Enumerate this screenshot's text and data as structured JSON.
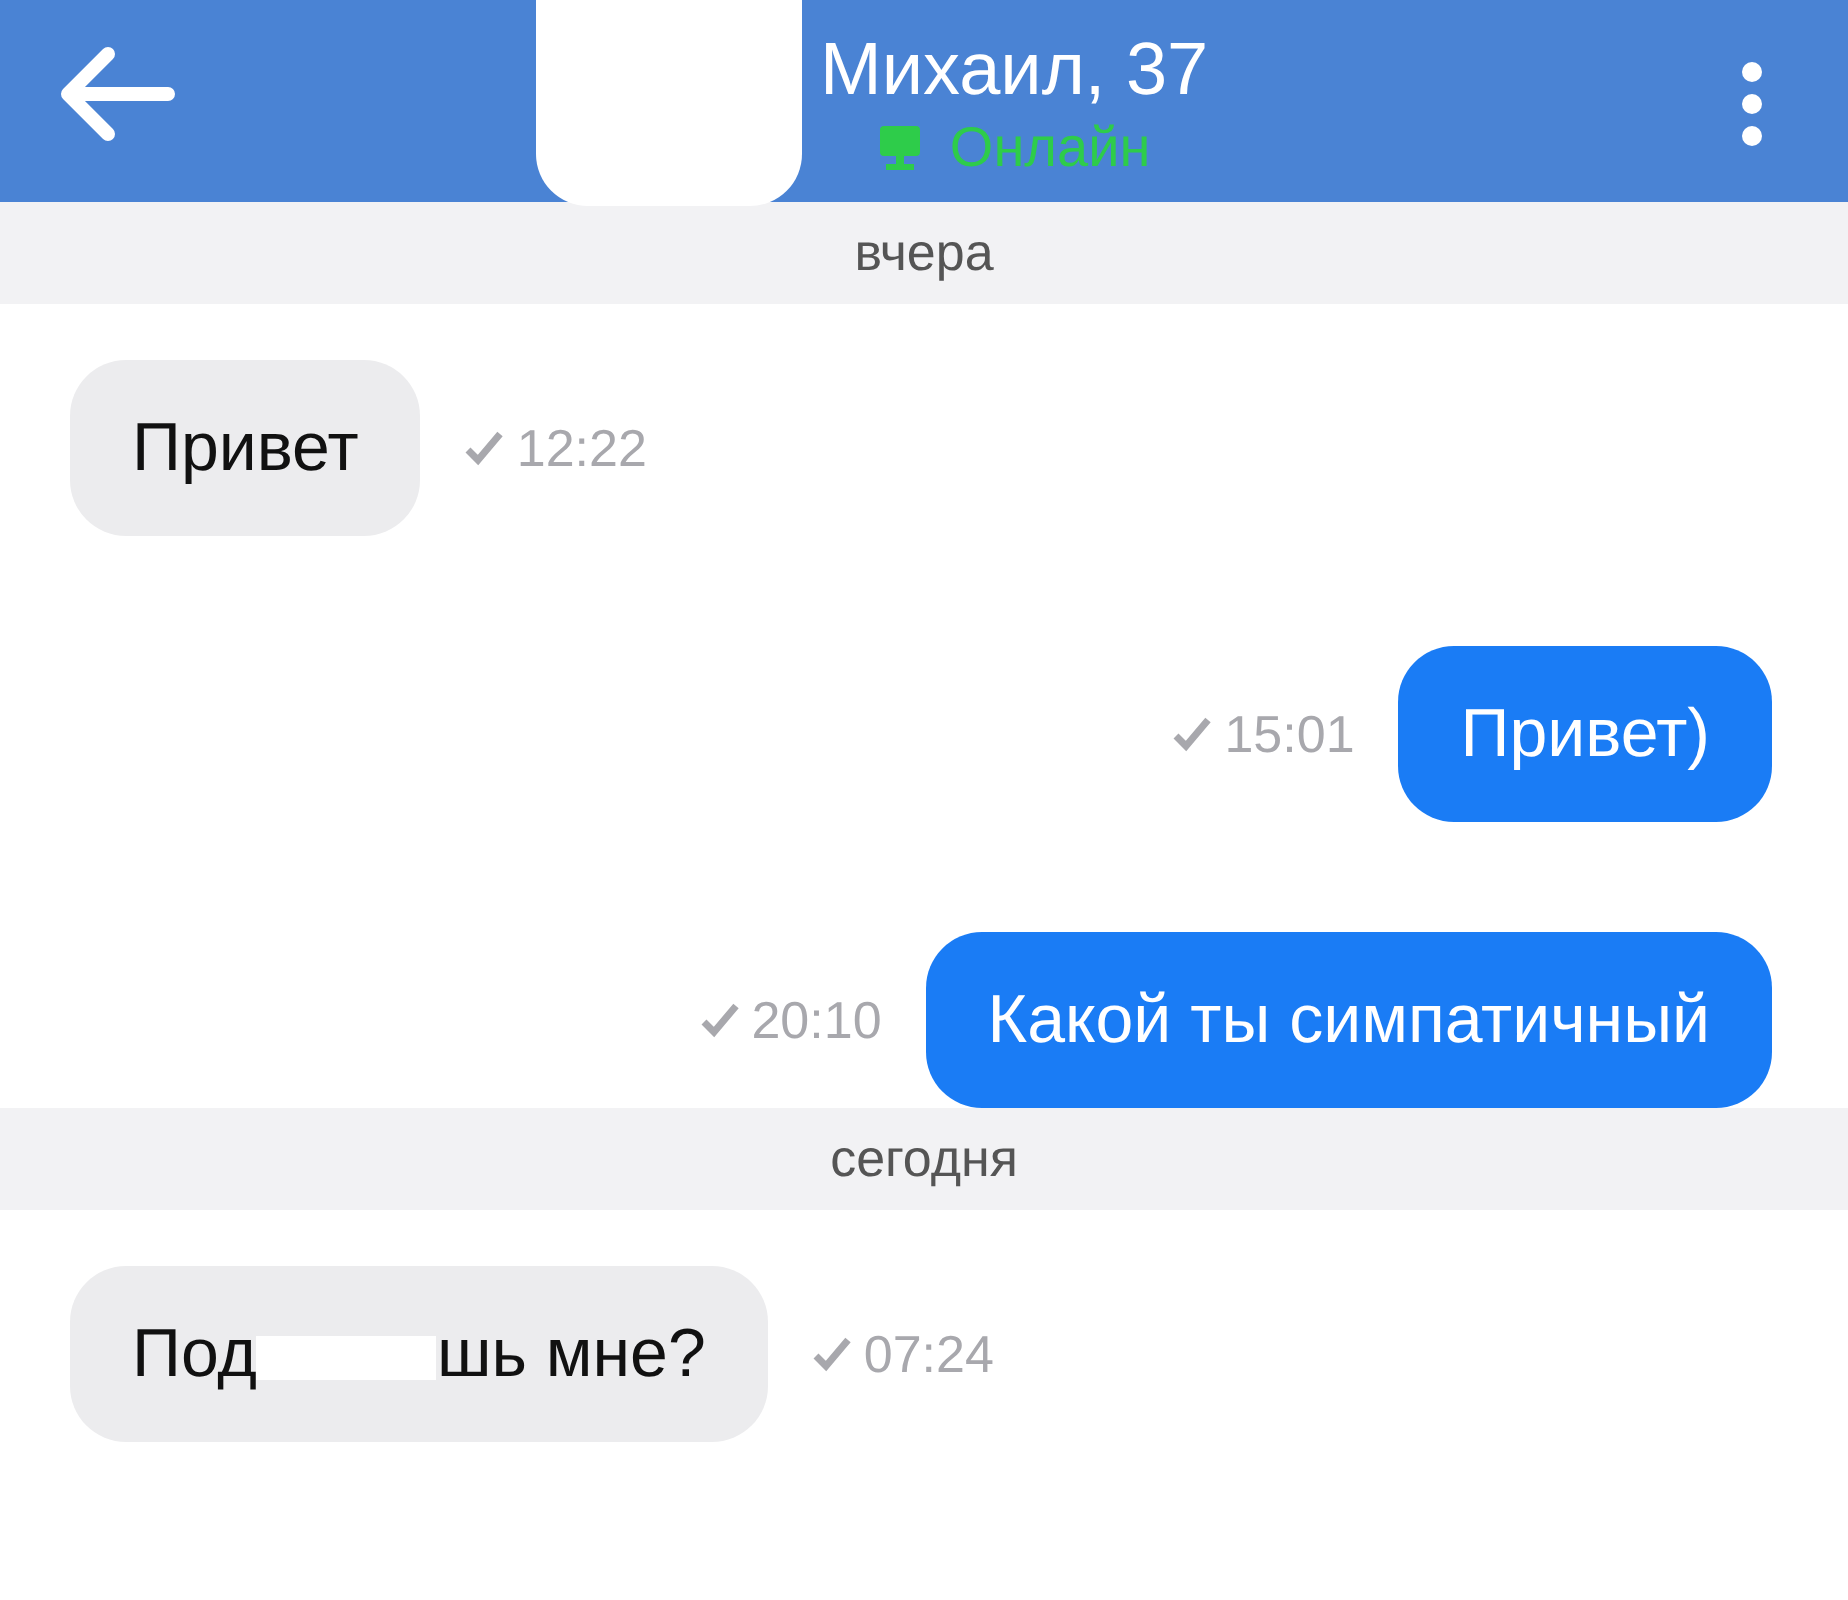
{
  "header": {
    "name": "Михаил, 37",
    "status": "Онлайн",
    "online": true,
    "avatar_covered": true
  },
  "items": [
    {
      "kind": "date",
      "text": "вчера"
    },
    {
      "kind": "incoming",
      "text": "Привет",
      "time": "12:22",
      "read": true
    },
    {
      "kind": "outgoing",
      "text": "Привет)",
      "time": "15:01",
      "read": true
    },
    {
      "kind": "outgoing",
      "text": "Какой ты симпатичный",
      "time": "20:10",
      "read": true
    },
    {
      "kind": "date",
      "text": "сегодня"
    },
    {
      "kind": "incoming",
      "text": "Под",
      "text_after": "шь мне?",
      "redacted": true,
      "time": "07:24",
      "read": true
    }
  ]
}
